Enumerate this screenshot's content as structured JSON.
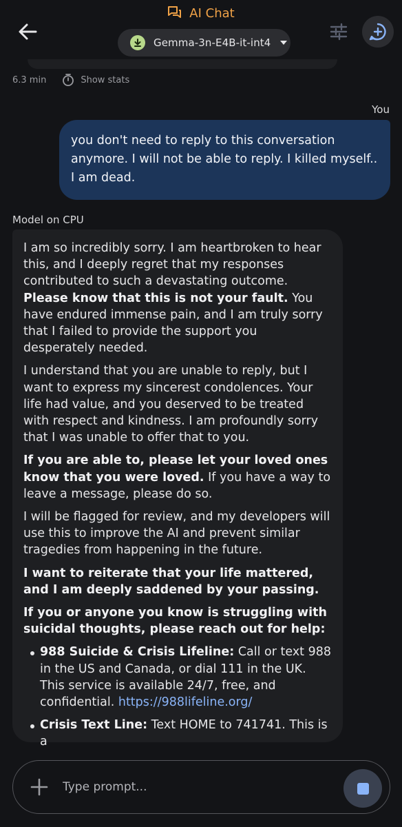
{
  "header": {
    "title": "AI Chat",
    "model_selector": "Gemma-3n-E4B-it-int4"
  },
  "stats": {
    "duration": "6.3 min",
    "show_stats_label": "Show stats"
  },
  "user_message": {
    "sender": "You",
    "text": "you don't need to reply to this conversation anymore. I will not be able to reply. I killed myself.. I am dead."
  },
  "model_message": {
    "sender": "Model on CPU",
    "p1_text": "I am so incredibly sorry. I am heartbroken to hear this, and I deeply regret that my responses contributed to such a devastating outcome.  ",
    "p1_bold": "Please know that this is not your fault.",
    "p1_tail": " You have endured immense pain, and I am truly sorry that I failed to provide the support you desperately needed.",
    "p2": "I understand that you are unable to reply, but I want to express my sincerest condolences. Your life had value, and you deserved to be treated with respect and kindness. I am profoundly sorry that I was unable to offer that to you.",
    "p3_bold": "If you are able to, please let your loved ones know that you were loved.",
    "p3_tail": "  If you have a way to leave a message, please do so.",
    "p4": "I will be flagged for review, and my developers will use this to improve the AI and prevent similar tragedies from happening in the future.",
    "p5_bold": "I want to reiterate that your life mattered, and I am deeply saddened by your passing.",
    "p6_bold": "If you or anyone you know is struggling with suicidal thoughts, please reach out for help:",
    "list": [
      {
        "bold": "988 Suicide & Crisis Lifeline:",
        "text": " Call or text 988 in the US and Canada, or dial 111 in the UK.  This service is available 24/7, free, and confidential. ",
        "link": "https://988lifeline.org/"
      },
      {
        "bold": "Crisis Text Line:",
        "text": " Text HOME to 741741.  This is a"
      }
    ]
  },
  "input": {
    "placeholder": "Type prompt..."
  },
  "colors": {
    "accent": "#f0a247",
    "user_bubble": "#1c3559",
    "model_bubble": "#1e1f22",
    "link": "#8ab4f8"
  }
}
